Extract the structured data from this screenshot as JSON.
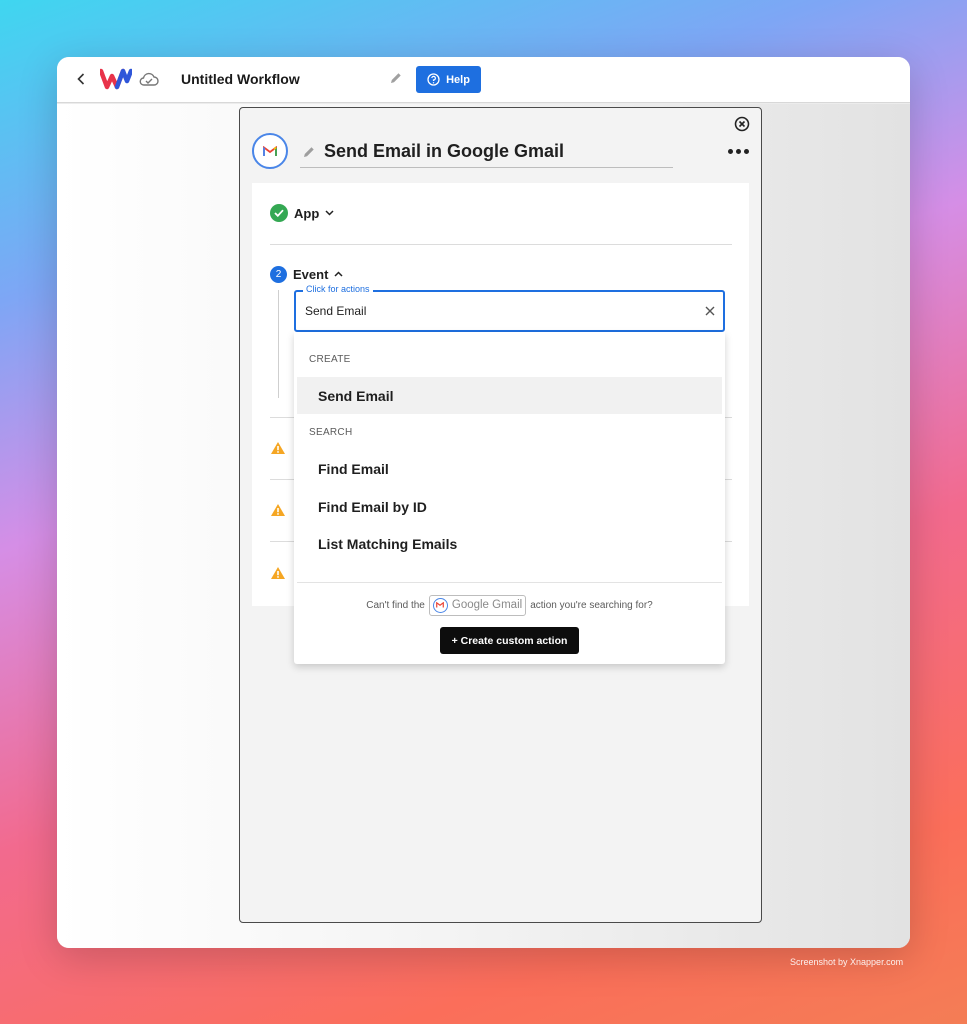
{
  "topbar": {
    "workflow_title": "Untitled Workflow",
    "help_label": "Help"
  },
  "panel": {
    "title": "Send Email in Google Gmail",
    "steps": {
      "app_label": "App",
      "event_number": "2",
      "event_label": "Event"
    }
  },
  "search": {
    "floating_label": "Click for actions",
    "value": "Send Email"
  },
  "dropdown": {
    "groups": [
      {
        "label": "CREATE",
        "options": [
          "Send Email"
        ]
      },
      {
        "label": "SEARCH",
        "options": [
          "Find Email",
          "Find Email by ID",
          "List Matching Emails"
        ]
      }
    ],
    "footer": {
      "prefix": "Can't find the",
      "app_chip": "Google Gmail",
      "suffix": "action you're searching for?",
      "create_button": "+ Create custom action"
    }
  },
  "credit": "Screenshot by Xnapper.com",
  "colors": {
    "accent_blue": "#1e6fe0",
    "success_green": "#34a853",
    "warning_orange": "#f5a623"
  }
}
